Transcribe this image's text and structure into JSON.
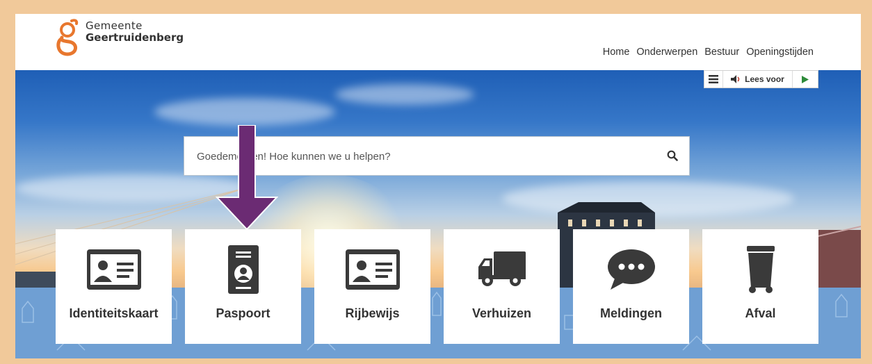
{
  "header": {
    "logo_line1": "Gemeente",
    "logo_line2": "Geertruidenberg",
    "nav": [
      "Home",
      "Onderwerpen",
      "Bestuur",
      "Openingstijden"
    ]
  },
  "readspeaker": {
    "label": "Lees voor"
  },
  "search": {
    "placeholder": "Goedemorgen! Hoe kunnen we u helpen?"
  },
  "tiles": [
    {
      "label": "Identiteitskaart",
      "icon": "id-card-icon"
    },
    {
      "label": "Paspoort",
      "icon": "passport-icon"
    },
    {
      "label": "Rijbewijs",
      "icon": "drivers-license-icon"
    },
    {
      "label": "Verhuizen",
      "icon": "truck-icon"
    },
    {
      "label": "Meldingen",
      "icon": "speech-bubble-icon"
    },
    {
      "label": "Afval",
      "icon": "trash-bin-icon"
    }
  ],
  "colors": {
    "brand_orange": "#e8772e",
    "frame": "#f1c99a",
    "arrow": "#6b2b73",
    "icon": "#3a3a3a"
  }
}
